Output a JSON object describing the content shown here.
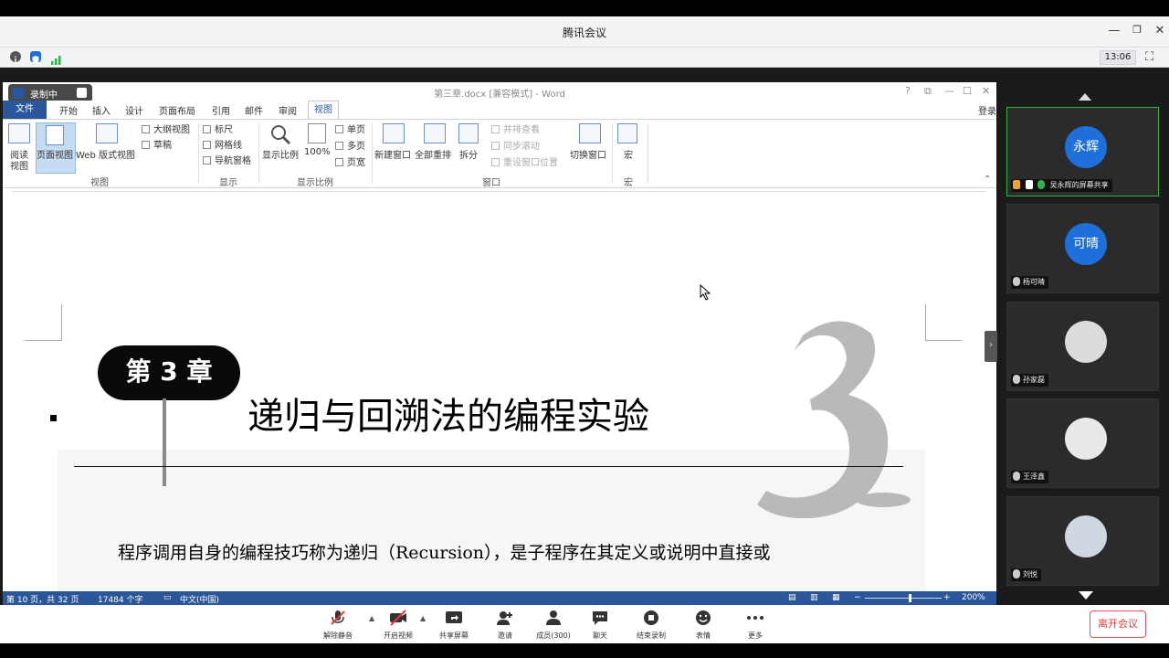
{
  "window": {
    "title": "腾讯会议",
    "time": "13:06"
  },
  "word": {
    "doc_title": "第三章.docx [兼容模式] - Word",
    "recording_label": "录制中",
    "tabs": {
      "file": "文件",
      "home": "开始",
      "insert": "插入",
      "design": "设计",
      "layout": "页面布局",
      "references": "引用",
      "mailings": "邮件",
      "review": "审阅",
      "view": "视图"
    },
    "login": "登录",
    "ribbon": {
      "read_mode_1": "阅读",
      "read_mode_2": "视图",
      "print_layout": "页面视图",
      "web_layout": "Web 版式视图",
      "outline": "大纲视图",
      "draft": "草稿",
      "group_views": "视图",
      "ruler": "标尺",
      "gridlines": "网格线",
      "nav_pane": "导航窗格",
      "group_show": "显示",
      "zoom": "显示比例",
      "zoom100": "100%",
      "one_page": "单页",
      "multi_page": "多页",
      "page_width": "页宽",
      "group_zoom": "显示比例",
      "new_window": "新建窗口",
      "arrange_all": "全部重排",
      "split": "拆分",
      "side_by_side": "并排查看",
      "sync_scroll": "同步滚动",
      "reset_pos": "重设窗口位置",
      "switch_windows": "切换窗口",
      "group_window": "窗口",
      "macros": "宏",
      "group_macros": "宏"
    },
    "doc": {
      "chapter_badge": "第 3 章",
      "chapter_title": "递归与回溯法的编程实验",
      "big_number": "3",
      "body_text": "程序调用自身的编程技巧称为递归（Recursion），是子程序在其定义或说明中直接或"
    },
    "status": {
      "page": "第 10 页，共 32 页",
      "words": "17484 个字",
      "lang": "中文(中国)",
      "zoom": "200%"
    }
  },
  "participants": [
    {
      "avatar_text": "永辉",
      "name": "吴永辉的屏幕共享",
      "avatar_color": "#1e6fd9"
    },
    {
      "avatar_text": "可晴",
      "name": "杨可晴",
      "avatar_color": "#1e6fd9"
    },
    {
      "avatar_text": "",
      "name": "孙家磊",
      "avatar_color": "#dcdcdc"
    },
    {
      "avatar_text": "",
      "name": "王泽鑫",
      "avatar_color": "#e8e8e8"
    },
    {
      "avatar_text": "",
      "name": "刘悦",
      "avatar_color": "#cfd8e0"
    }
  ],
  "toolbar": {
    "unmute": "解除静音",
    "start_video": "开启视频",
    "share_screen": "共享屏幕",
    "invite": "邀请",
    "members": "成员(300)",
    "chat": "聊天",
    "end_recording": "结束录制",
    "reactions": "表情",
    "more": "更多",
    "leave": "离开会议"
  },
  "colors": {
    "word_blue": "#2b579a",
    "meeting_blue": "#1e6fd9",
    "leave_red": "#e03c3c"
  }
}
